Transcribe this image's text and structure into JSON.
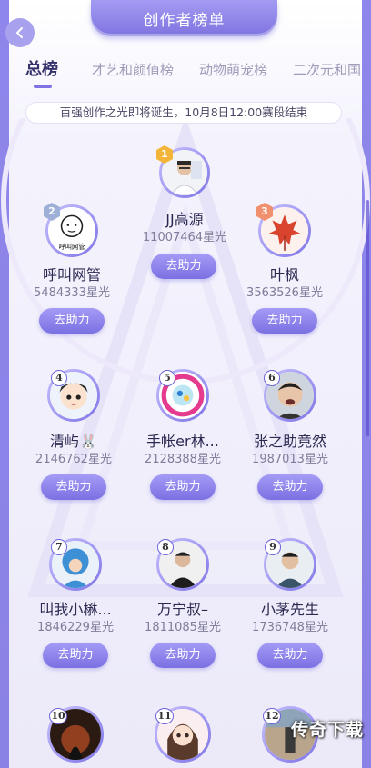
{
  "header": {
    "title": "创作者榜单"
  },
  "tabs": [
    {
      "label": "总榜",
      "active": true
    },
    {
      "label": "才艺和颜值榜",
      "active": false
    },
    {
      "label": "动物萌宠榜",
      "active": false
    },
    {
      "label": "二次元和国",
      "active": false
    }
  ],
  "notice": "百强创作之光即将诞生，10月8日12:00赛段结束",
  "help_label": "去助力",
  "ranking": [
    {
      "rank": "1",
      "name": "JJ高源",
      "score": "11007464星光",
      "avatar": "person-in-white-shirt"
    },
    {
      "rank": "2",
      "name": "呼叫网管",
      "score": "5484333星光",
      "avatar": "cartoon-face",
      "avatar_text": "呼叫网管"
    },
    {
      "rank": "3",
      "name": "叶枫",
      "score": "3563526星光",
      "avatar": "red-maple-leaf"
    },
    {
      "rank": "4",
      "name": "清屿🐰",
      "score": "2146762星光",
      "avatar": "cartoon-boy"
    },
    {
      "rank": "5",
      "name": "手帐er林...",
      "score": "2128388星光",
      "avatar": "colorful-sticker"
    },
    {
      "rank": "6",
      "name": "张之助竟然",
      "score": "1987013星光",
      "avatar": "crying-person"
    },
    {
      "rank": "7",
      "name": "叫我小楙...",
      "score": "1846229星光",
      "avatar": "blue-costume"
    },
    {
      "rank": "8",
      "name": "万宁叔–",
      "score": "1811085星光",
      "avatar": "man-in-black"
    },
    {
      "rank": "9",
      "name": "小茅先生",
      "score": "1736748星光",
      "avatar": "man-portrait"
    },
    {
      "rank": "10",
      "name": "",
      "score": "",
      "avatar": "dark-sunset"
    },
    {
      "rank": "11",
      "name": "",
      "score": "",
      "avatar": "anime-girl"
    },
    {
      "rank": "12",
      "name": "",
      "score": "",
      "avatar": "street-photo"
    }
  ],
  "watermark": "传奇下载",
  "colors": {
    "accent": "#7f73e4",
    "gold": "#f2b53a",
    "silver": "#9fb0d8",
    "bronze": "#f0906e"
  }
}
